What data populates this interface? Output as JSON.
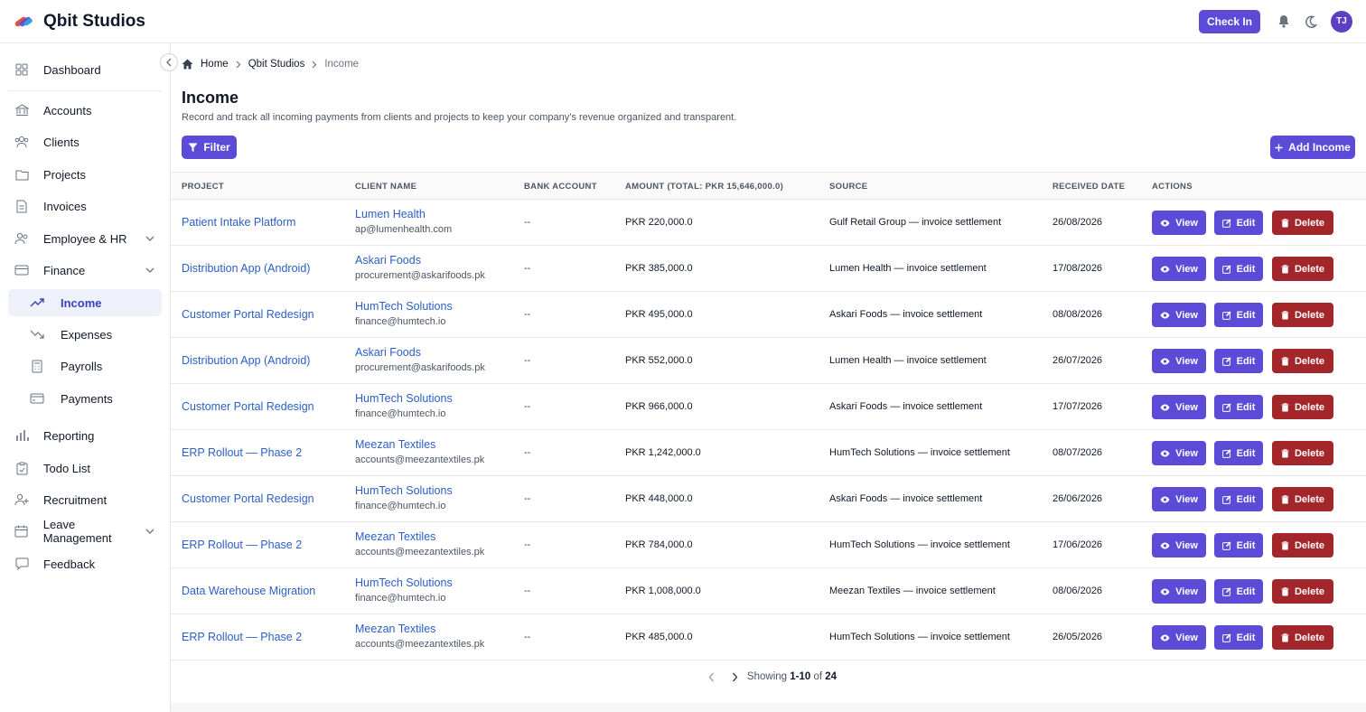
{
  "app": {
    "name": "Qbit Studios"
  },
  "header": {
    "checkin_label": "Check In",
    "avatar_initials": "TJ"
  },
  "sidebar": {
    "items": [
      {
        "label": "Dashboard",
        "icon": "grid-icon"
      },
      {
        "label": "Accounts",
        "icon": "bank-icon"
      },
      {
        "label": "Clients",
        "icon": "users-icon"
      },
      {
        "label": "Projects",
        "icon": "folder-icon"
      },
      {
        "label": "Invoices",
        "icon": "document-icon"
      },
      {
        "label": "Employee & HR",
        "icon": "user-group-icon"
      },
      {
        "label": "Finance",
        "icon": "card-icon"
      },
      {
        "label": "Income",
        "icon": "trending-up-icon"
      },
      {
        "label": "Expenses",
        "icon": "trending-down-icon"
      },
      {
        "label": "Payrolls",
        "icon": "calculator-icon"
      },
      {
        "label": "Payments",
        "icon": "wallet-icon"
      },
      {
        "label": "Reporting",
        "icon": "bar-chart-icon"
      },
      {
        "label": "Todo List",
        "icon": "clipboard-icon"
      },
      {
        "label": "Recruitment",
        "icon": "user-plus-icon"
      },
      {
        "label": "Leave Management",
        "icon": "calendar-icon"
      },
      {
        "label": "Feedback",
        "icon": "chat-icon"
      }
    ]
  },
  "breadcrumb": {
    "home": "Home",
    "org": "Qbit Studios",
    "current": "Income"
  },
  "page": {
    "title": "Income",
    "description": "Record and track all incoming payments from clients and projects to keep your company’s revenue organized and transparent.",
    "filter_label": "Filter",
    "add_label": "Add Income"
  },
  "table": {
    "headers": {
      "project": "PROJECT",
      "client": "CLIENT NAME",
      "bank": "BANK ACCOUNT",
      "amount": "AMOUNT",
      "amount_total": "(TOTAL: PKR 15,646,000.0)",
      "source": "SOURCE",
      "date": "RECEIVED DATE",
      "actions": "ACTIONS"
    },
    "action_labels": {
      "view": "View",
      "edit": "Edit",
      "delete": "Delete"
    },
    "rows": [
      {
        "project": "Patient Intake Platform",
        "client": "Lumen Health",
        "email": "ap@lumenhealth.com",
        "bank": "--",
        "amount": "PKR 220,000.0",
        "source": "Gulf Retail Group — invoice settlement",
        "date": "26/08/2026"
      },
      {
        "project": "Distribution App (Android)",
        "client": "Askari Foods",
        "email": "procurement@askarifoods.pk",
        "bank": "--",
        "amount": "PKR 385,000.0",
        "source": "Lumen Health — invoice settlement",
        "date": "17/08/2026"
      },
      {
        "project": "Customer Portal Redesign",
        "client": "HumTech Solutions",
        "email": "finance@humtech.io",
        "bank": "--",
        "amount": "PKR 495,000.0",
        "source": "Askari Foods — invoice settlement",
        "date": "08/08/2026"
      },
      {
        "project": "Distribution App (Android)",
        "client": "Askari Foods",
        "email": "procurement@askarifoods.pk",
        "bank": "--",
        "amount": "PKR 552,000.0",
        "source": "Lumen Health — invoice settlement",
        "date": "26/07/2026"
      },
      {
        "project": "Customer Portal Redesign",
        "client": "HumTech Solutions",
        "email": "finance@humtech.io",
        "bank": "--",
        "amount": "PKR 966,000.0",
        "source": "Askari Foods — invoice settlement",
        "date": "17/07/2026"
      },
      {
        "project": "ERP Rollout — Phase 2",
        "client": "Meezan Textiles",
        "email": "accounts@meezantextiles.pk",
        "bank": "--",
        "amount": "PKR 1,242,000.0",
        "source": "HumTech Solutions — invoice settlement",
        "date": "08/07/2026"
      },
      {
        "project": "Customer Portal Redesign",
        "client": "HumTech Solutions",
        "email": "finance@humtech.io",
        "bank": "--",
        "amount": "PKR 448,000.0",
        "source": "Askari Foods — invoice settlement",
        "date": "26/06/2026"
      },
      {
        "project": "ERP Rollout — Phase 2",
        "client": "Meezan Textiles",
        "email": "accounts@meezantextiles.pk",
        "bank": "--",
        "amount": "PKR 784,000.0",
        "source": "HumTech Solutions — invoice settlement",
        "date": "17/06/2026"
      },
      {
        "project": "Data Warehouse Migration",
        "client": "HumTech Solutions",
        "email": "finance@humtech.io",
        "bank": "--",
        "amount": "PKR 1,008,000.0",
        "source": "Meezan Textiles — invoice settlement",
        "date": "08/06/2026"
      },
      {
        "project": "ERP Rollout — Phase 2",
        "client": "Meezan Textiles",
        "email": "accounts@meezantextiles.pk",
        "bank": "--",
        "amount": "PKR 485,000.0",
        "source": "HumTech Solutions — invoice settlement",
        "date": "26/05/2026"
      }
    ]
  },
  "pagination": {
    "showing_prefix": "Showing",
    "range": "1-10",
    "of_label": "of",
    "total": "24"
  },
  "colors": {
    "accent": "#5b4bd6",
    "danger": "#a3262a",
    "link": "#2b5fc4",
    "active_bg": "#eef0fa"
  }
}
